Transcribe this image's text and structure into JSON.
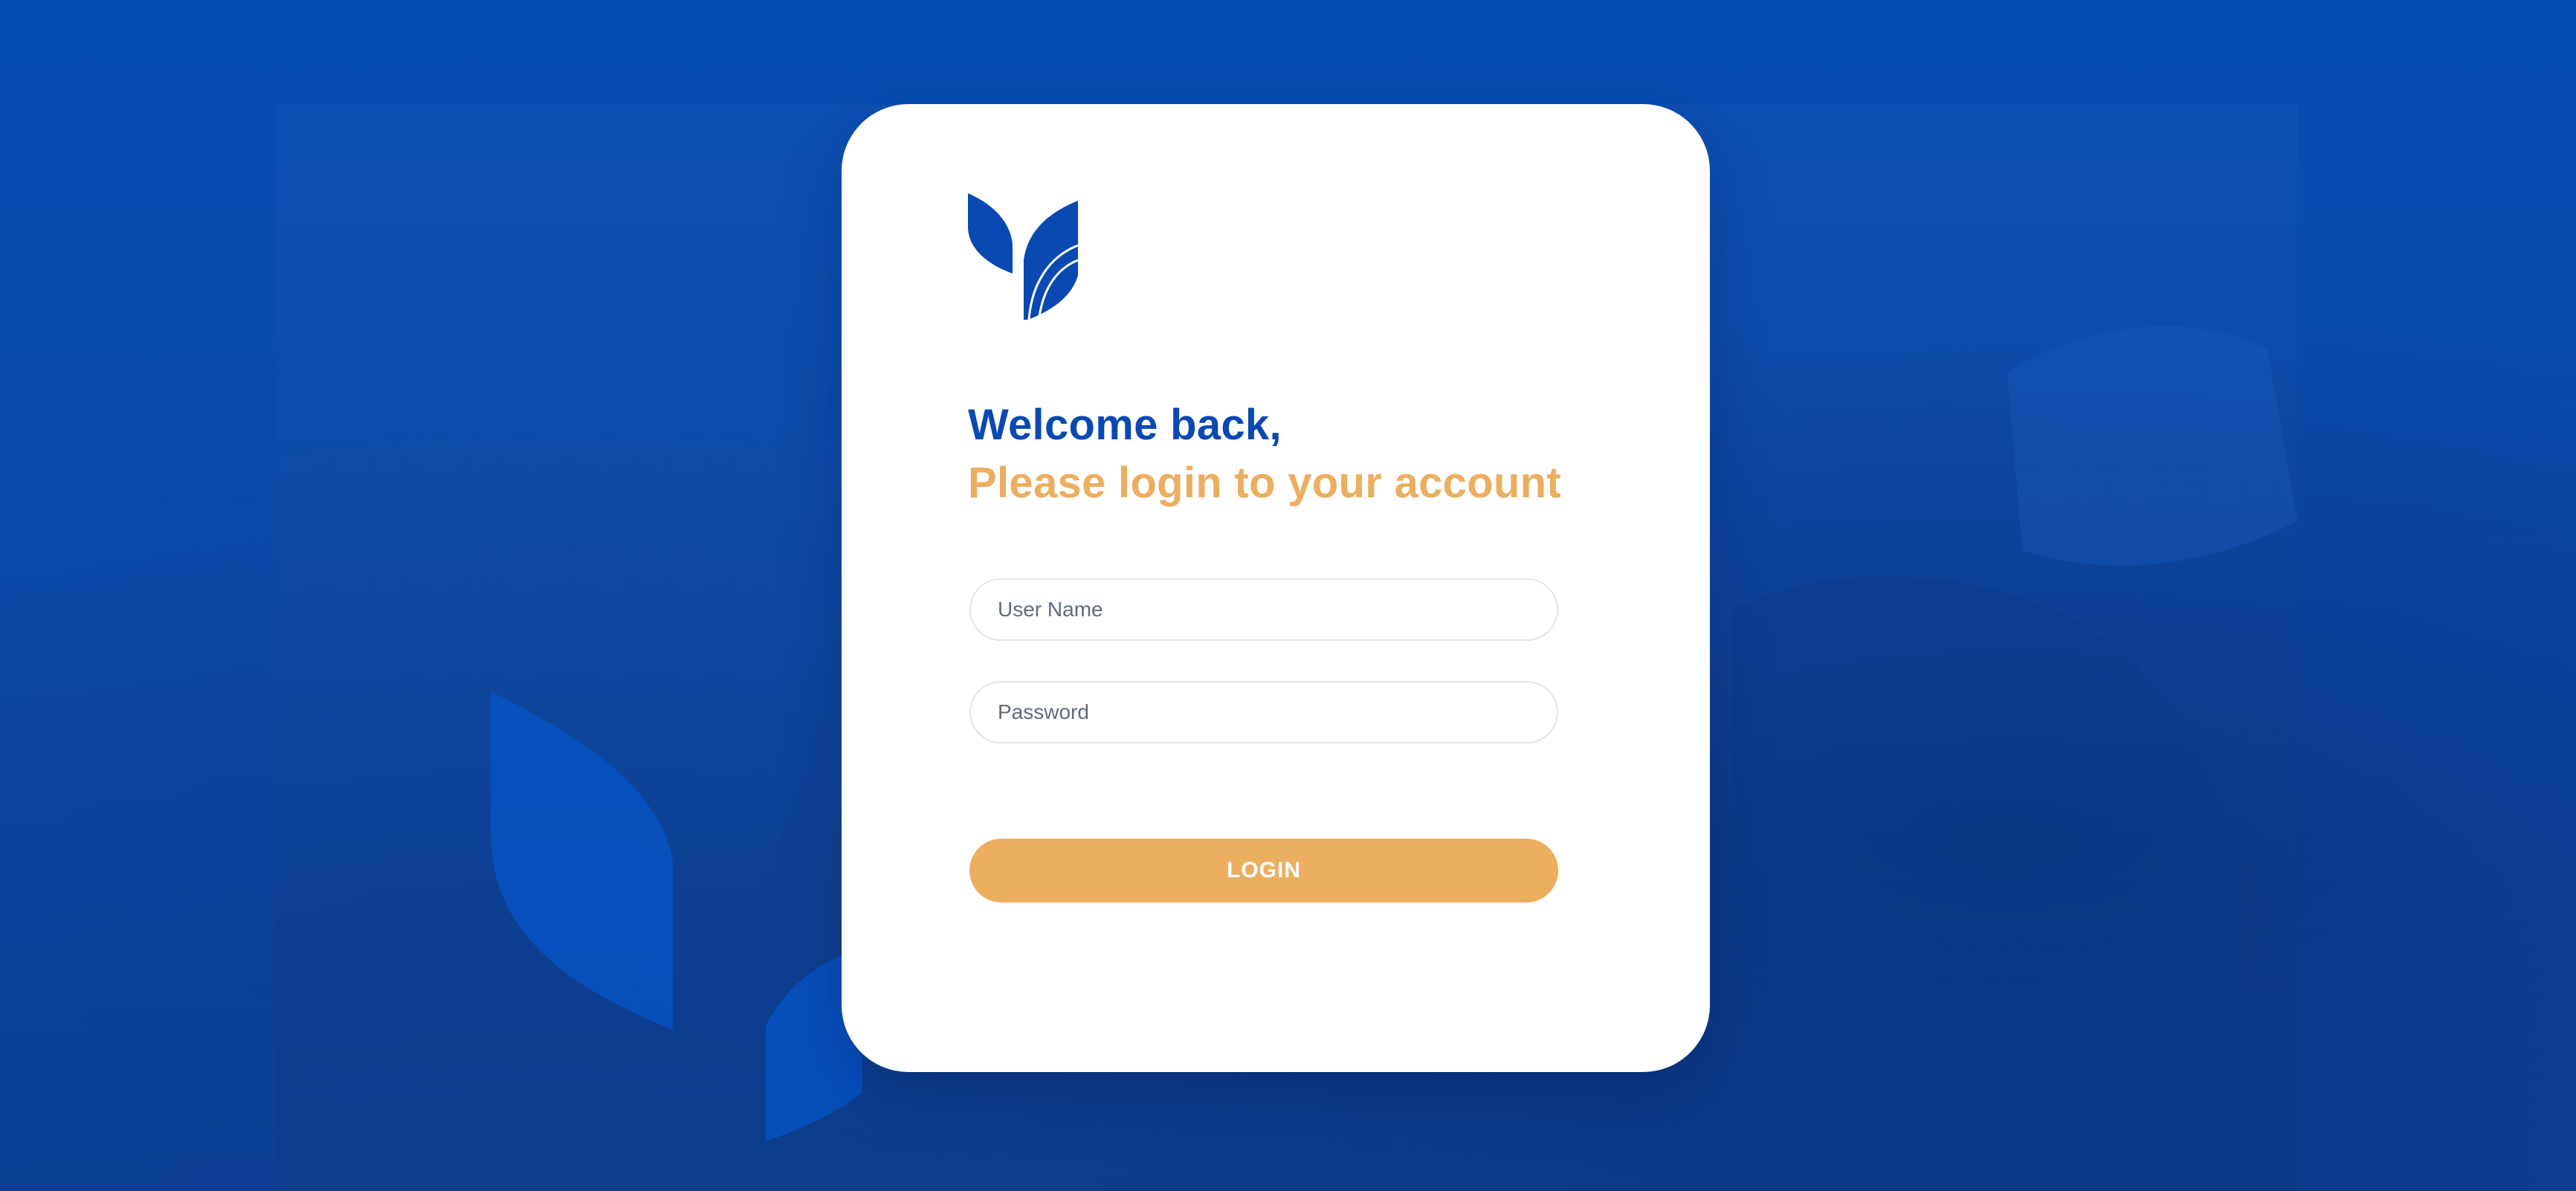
{
  "brand": {
    "logo_icon": "leaf-logo-icon",
    "primary_color": "#0a49b2",
    "accent_color": "#ecae5f"
  },
  "login": {
    "welcome": "Welcome back,",
    "subtitle": "Please login to your account",
    "username_placeholder": "User Name",
    "password_placeholder": "Password",
    "button_label": "LOGIN"
  }
}
